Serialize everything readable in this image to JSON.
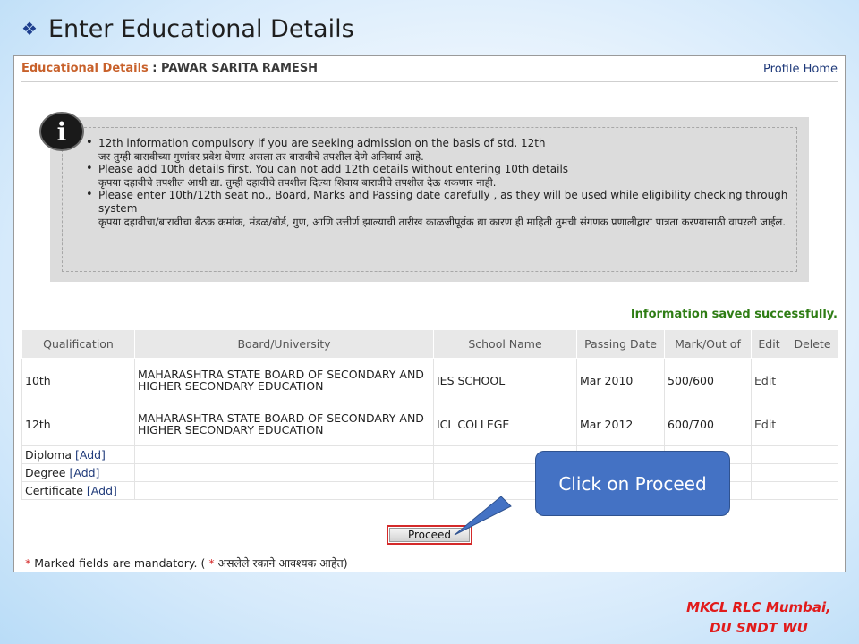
{
  "slide": {
    "bullet_icon": "❖",
    "title": "Enter Educational Details"
  },
  "header": {
    "section": "Educational Details",
    "separator": " : ",
    "student_name": "PAWAR SARITA RAMESH",
    "profile_link": "Profile Home"
  },
  "info": {
    "icon_glyph": "i",
    "items": [
      {
        "en": "",
        "mr": ""
      },
      {
        "en": "12th information compulsory if you are seeking admission on the basis of std. 12th",
        "mr": "जर तुम्ही बारावीच्या गुणांवर प्रवेश घेणार असला तर बारावीचे तपशील देणे अनिवार्य आहे."
      },
      {
        "en": "Please add 10th details first. You can not add 12th details without entering 10th details",
        "mr": "कृपया दहावीचे तपशील आधी द्या. तुम्ही दहावीचे तपशील दिल्या शिवाय बारावीचे तपशील देऊ शकणार नाही."
      },
      {
        "en": "Please enter 10th/12th seat no., Board, Marks and Passing date carefully , as they will be used while eligibility checking through system",
        "mr": "कृपया दहावीचा/बारावीचा बैठक क्रमांक, मंडळ/बोर्ड, गुण, आणि उत्तीर्ण झाल्याची तारीख काळजीपूर्वक द्या कारण ही माहिती तुमची संगणक प्रणालीद्वारा पात्रता करण्यासाठी वापरली जाईल."
      }
    ]
  },
  "status": {
    "success_message": "Information saved successfully."
  },
  "table": {
    "headers": {
      "qualification": "Qualification",
      "board": "Board/University",
      "school": "School Name",
      "passing_date": "Passing Date",
      "marks": "Mark/Out of",
      "edit": "Edit",
      "delete": "Delete"
    },
    "rows": [
      {
        "qualification": "10th",
        "board": "MAHARASHTRA STATE BOARD OF SECONDARY AND HIGHER SECONDARY EDUCATION",
        "school": "IES SCHOOL",
        "passing_date": "Mar 2010",
        "marks": "500/600",
        "edit": "Edit",
        "delete": ""
      },
      {
        "qualification": "12th",
        "board": "MAHARASHTRA STATE BOARD OF SECONDARY AND HIGHER SECONDARY EDUCATION",
        "school": "ICL COLLEGE",
        "passing_date": "Mar 2012",
        "marks": "600/700",
        "edit": "Edit",
        "delete": ""
      }
    ],
    "add_rows": [
      {
        "label": "Diploma",
        "link": "[Add]"
      },
      {
        "label": "Degree",
        "link": "[Add]"
      },
      {
        "label": "Certificate",
        "link": "[Add]"
      }
    ]
  },
  "actions": {
    "proceed_label": "Proceed"
  },
  "footnote": {
    "star": "*",
    "text_en": " Marked fields are mandatory. ( ",
    "star2": "*",
    "text_mr": " असलेले रकाने आवश्यक आहेत)"
  },
  "callout": {
    "text": "Click on Proceed"
  },
  "footer": {
    "line1": "MKCL RLC Mumbai,",
    "line2": "DU SNDT WU"
  },
  "colors": {
    "section_title": "#c8612b",
    "success": "#2e7d14",
    "callout_fill": "#4472c4",
    "highlight_border": "#d42a2a",
    "footer_text": "#e11b1b"
  }
}
